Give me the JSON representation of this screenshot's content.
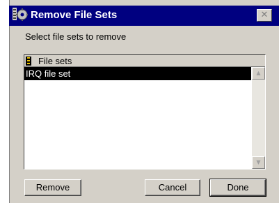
{
  "window": {
    "title": "Remove File Sets",
    "icon": "gear-app-icon",
    "close_glyph": "✕"
  },
  "prompt": "Select file sets to remove",
  "list": {
    "header_label": "File sets",
    "header_icon": "file-set-icon",
    "items": [
      {
        "label": "IRQ file set",
        "selected": true
      }
    ]
  },
  "scrollbar": {
    "up_glyph": "▲",
    "down_glyph": "▼"
  },
  "buttons": {
    "remove": "Remove",
    "cancel": "Cancel",
    "done": "Done"
  },
  "colors": {
    "titlebar": "#000080",
    "face": "#d4d0c8",
    "selection": "#000000"
  }
}
